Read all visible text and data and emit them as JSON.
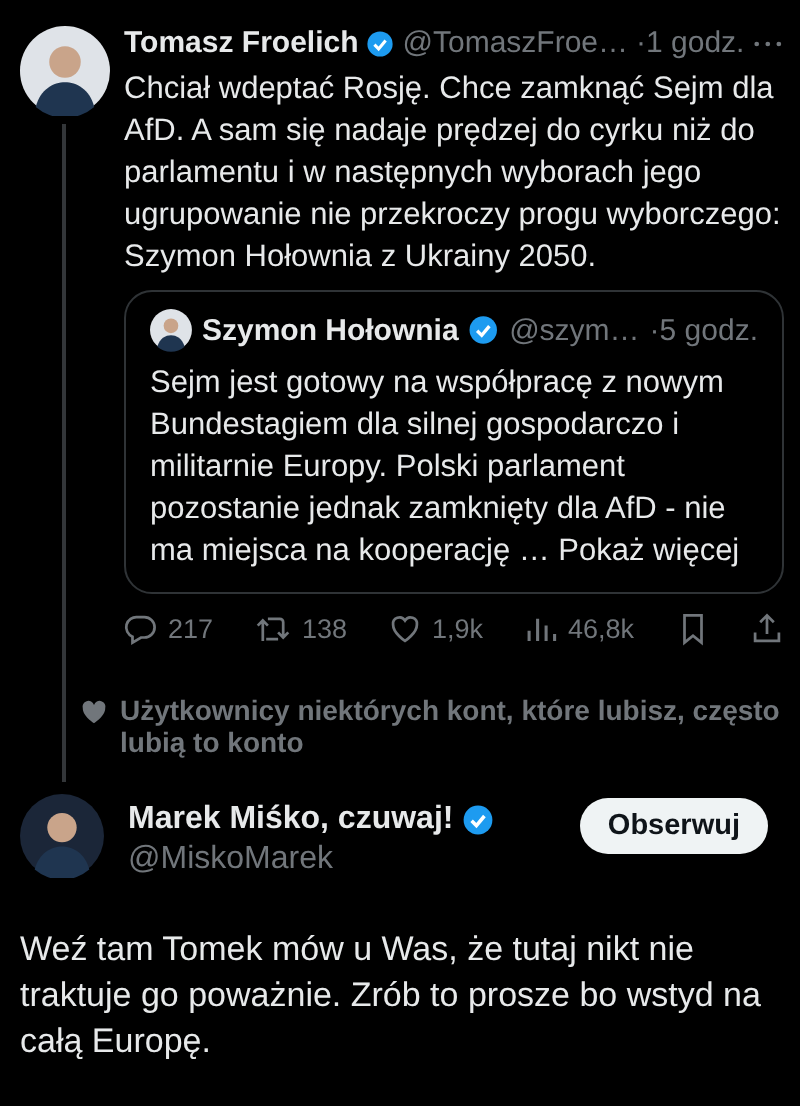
{
  "tweet": {
    "author": "Tomasz Froelich",
    "verified": true,
    "handle": "@TomaszFroe…",
    "time": "·1 godz.",
    "text": "Chciał wdeptać Rosję. Chce zamknąć Sejm dla AfD. A sam się nadaje prędzej do cyrku niż do parlamentu i w następnych wyborach jego ugrupowanie nie przekroczy progu wyborczego: Szymon Hołownia z Ukrainy 2050.",
    "quote": {
      "author": "Szymon Hołownia",
      "verified": true,
      "handle": "@szym…",
      "time": "·5 godz.",
      "text": "Sejm jest gotowy na współpracę z nowym Bundestagiem dla silnej gospodarczo i militarnie Europy. Polski parlament pozostanie jednak zamknięty dla AfD - nie ma miejsca na kooperację …",
      "more": "Pokaż więcej"
    },
    "stats": [
      {
        "kind": "reply",
        "count": "217"
      },
      {
        "kind": "repost",
        "count": "138"
      },
      {
        "kind": "like",
        "count": "1,9k"
      },
      {
        "kind": "views",
        "count": "46,8k"
      },
      {
        "kind": "bookmark"
      },
      {
        "kind": "share"
      }
    ]
  },
  "social_context": "Użytkownicy niektórych kont, które lubisz, często lubią to konto",
  "reply": {
    "author": "Marek Miśko, czuwaj!",
    "verified": true,
    "handle": "@MiskoMarek",
    "follow_button": "Obserwuj",
    "text": "Weź tam Tomek mów u Was, że tutaj nikt nie traktuje go poważnie. Zrób to prosze bo wstyd na całą Europę."
  }
}
